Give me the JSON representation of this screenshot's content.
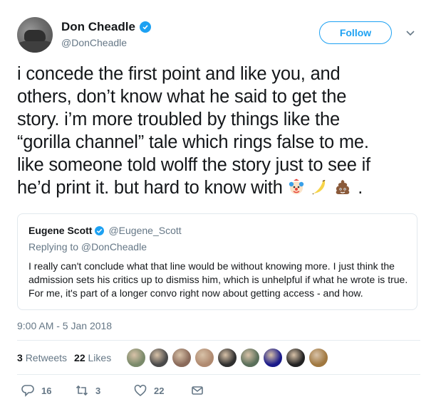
{
  "user": {
    "display_name": "Don Cheadle",
    "handle": "@DonCheadle",
    "follow_label": "Follow"
  },
  "tweet": {
    "line1": "i concede the first point and like you, and",
    "line2": "others, don’t know what he said to get the",
    "line3": "story. i’m more troubled by things like the",
    "line4": "“gorilla channel” tale which rings false to me.",
    "line5": "like someone told wolff the story just to see if",
    "line6_text": "he’d print it. but hard to know with",
    "line6_end": ".",
    "emojis": [
      "clown-face",
      "banana",
      "pile-of-poo"
    ]
  },
  "quoted": {
    "display_name": "Eugene Scott",
    "handle": "@Eugene_Scott",
    "replying_to": "Replying to @DonCheadle",
    "body": "I really can't conclude what that line would be without knowing more. I just think the admission sets his critics up to dismiss him, which is unhelpful if what he wrote is true. For me, it's part of a longer convo right now about getting access - and how."
  },
  "timestamp": "9:00 AM - 5 Jan 2018",
  "stats": {
    "retweets_count": "3",
    "retweets_label": "Retweets",
    "likes_count": "22",
    "likes_label": "Likes"
  },
  "likers": [
    "#7a8a6a",
    "#4a4a4a",
    "#8a6a5a",
    "#b08a70",
    "#2f2f2f",
    "#5a6f5a",
    "#1a1a8a",
    "#222222",
    "#a07840"
  ],
  "actions": {
    "reply_count": "16",
    "retweet_count": "3",
    "like_count": "22"
  },
  "colors": {
    "accent": "#1da1f2",
    "secondary_text": "#657786"
  }
}
